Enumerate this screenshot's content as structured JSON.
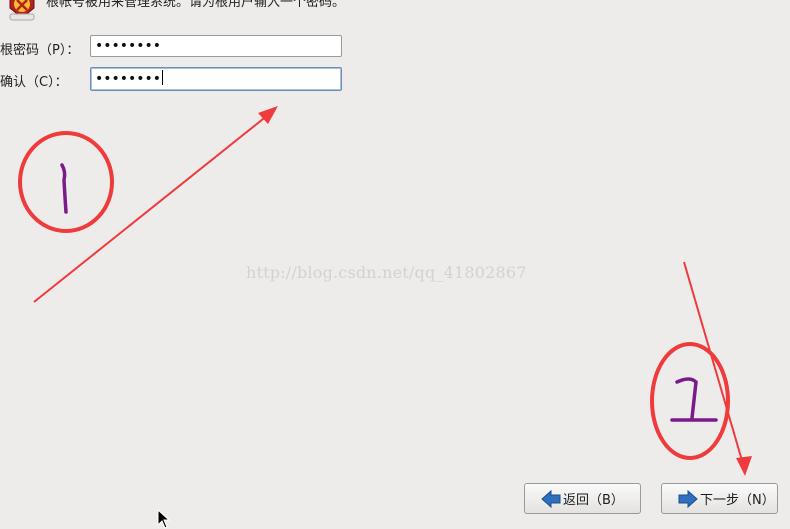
{
  "header": {
    "text": "根帐号被用来管理系统。请为根用户输入一个密码。",
    "icon": "root-user-warning-icon"
  },
  "form": {
    "root_password": {
      "label": "根密码（P）：",
      "value": "••••••••"
    },
    "confirm_password": {
      "label": "确认（C）：",
      "value": "••••••••"
    }
  },
  "watermark": "http://blog.csdn.net/qq_41802867",
  "buttons": {
    "back_label": "返回（B）",
    "next_label": "下一步（N）"
  },
  "annotations": {
    "step1": "1",
    "step2": "2",
    "circle_color": "#ef3b3b",
    "digit_color": "#7b1a8a"
  },
  "colors": {
    "background": "#edeceb",
    "arrow_blue": "#2f6fbf"
  }
}
